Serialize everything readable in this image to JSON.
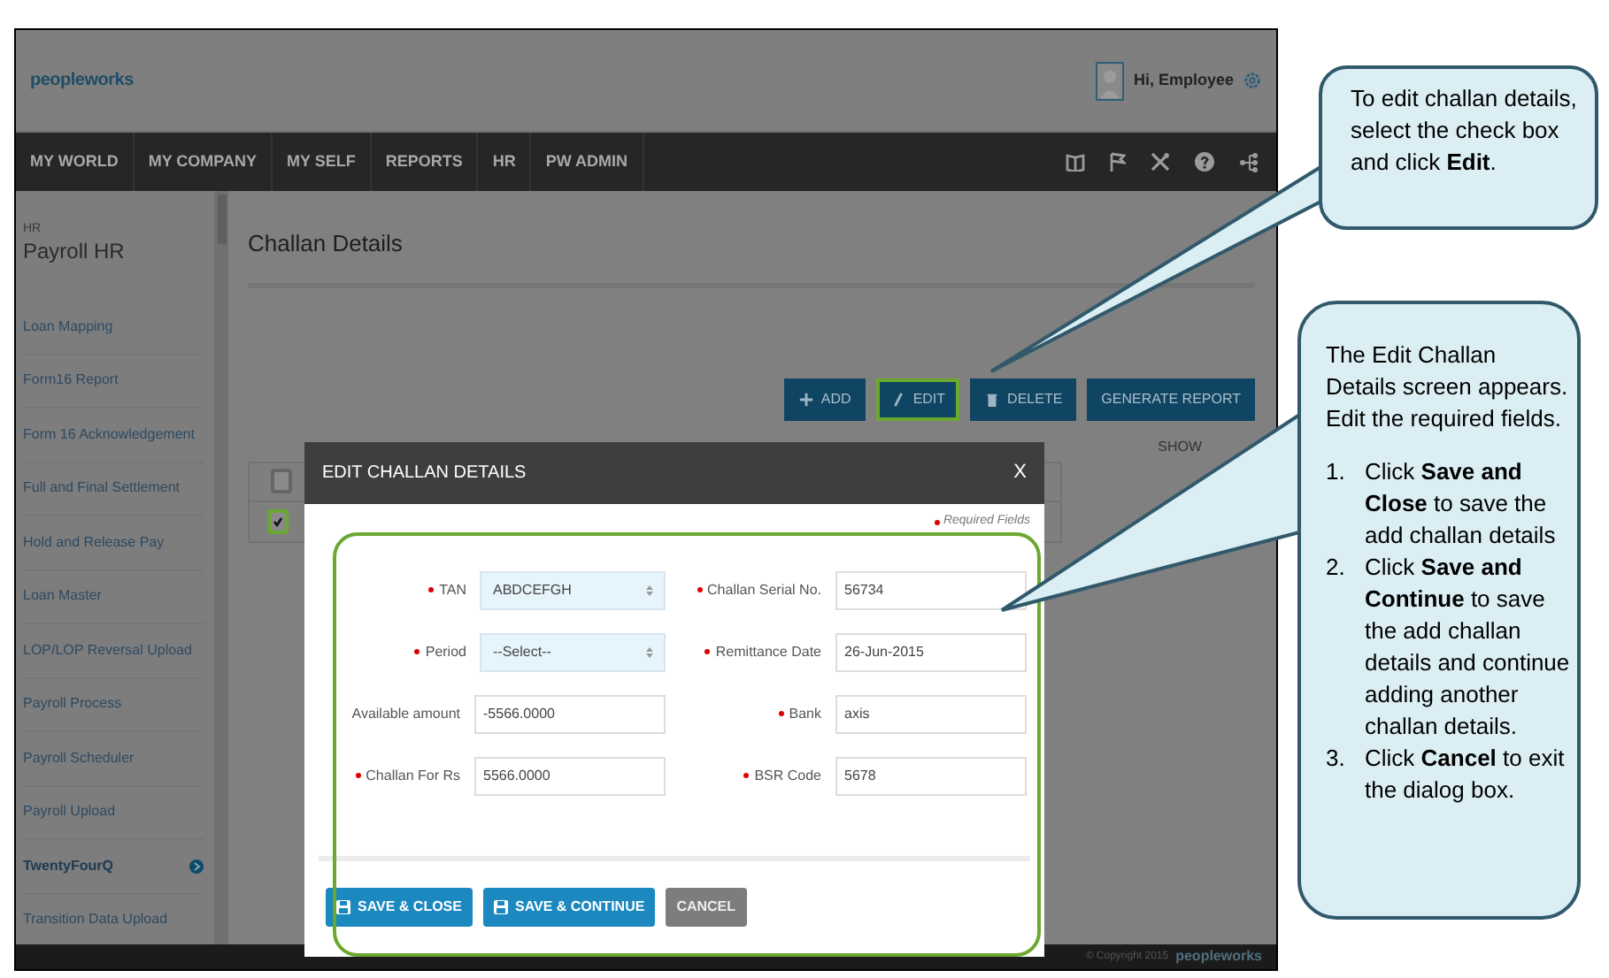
{
  "header": {
    "logo": "peopleworks",
    "greeting": "Hi, Employee"
  },
  "nav": {
    "items": [
      "MY WORLD",
      "MY COMPANY",
      "MY SELF",
      "REPORTS",
      "HR",
      "PW ADMIN"
    ]
  },
  "sidebar": {
    "section": "HR",
    "title": "Payroll HR",
    "items": [
      {
        "label": "Loan Mapping",
        "selected": false
      },
      {
        "label": "Form16 Report",
        "selected": false
      },
      {
        "label": "Form 16 Acknowledgement",
        "selected": false
      },
      {
        "label": "Full and Final Settlement",
        "selected": false
      },
      {
        "label": "Hold and Release Pay",
        "selected": false
      },
      {
        "label": "Loan Master",
        "selected": false
      },
      {
        "label": "LOP/LOP Reversal Upload",
        "selected": false
      },
      {
        "label": "Payroll Process",
        "selected": false
      },
      {
        "label": "Payroll Scheduler",
        "selected": false
      },
      {
        "label": "Payroll Upload",
        "selected": false
      },
      {
        "label": "TwentyFourQ",
        "selected": true
      },
      {
        "label": "Transition Data Upload",
        "selected": false
      }
    ]
  },
  "page": {
    "title": "Challan Details",
    "toolbar": [
      {
        "kind": "add",
        "label": "ADD",
        "highlighted": false
      },
      {
        "kind": "edit",
        "label": "EDIT",
        "highlighted": true
      },
      {
        "kind": "delete",
        "label": "DELETE",
        "highlighted": false
      },
      {
        "kind": "report",
        "label": "GENERATE REPORT",
        "highlighted": false
      }
    ],
    "show_label": "SHOW",
    "table": {
      "header_checked": false,
      "rows": [
        {
          "checked": true,
          "highlighted": true
        }
      ]
    }
  },
  "dialog": {
    "title": "EDIT CHALLAN DETAILS",
    "close": "X",
    "required_note": "Required Fields",
    "fields": [
      {
        "label": "TAN",
        "required": true,
        "kind": "select",
        "value": "ABDCEFGH"
      },
      {
        "label": "Challan Serial No.",
        "required": true,
        "kind": "text",
        "value": "56734"
      },
      {
        "label": "Period",
        "required": true,
        "kind": "select",
        "value": "--Select--"
      },
      {
        "label": "Remittance Date",
        "required": true,
        "kind": "text",
        "value": "26-Jun-2015"
      },
      {
        "label": "Available amount",
        "required": false,
        "kind": "text",
        "value": "-5566.0000"
      },
      {
        "label": "Bank",
        "required": true,
        "kind": "text",
        "value": "axis"
      },
      {
        "label": "Challan For Rs",
        "required": true,
        "kind": "text",
        "value": "5566.0000"
      },
      {
        "label": "BSR Code",
        "required": true,
        "kind": "text",
        "value": "5678"
      }
    ],
    "buttons": [
      {
        "kind": "save",
        "label": "SAVE & CLOSE"
      },
      {
        "kind": "save",
        "label": "SAVE & CONTINUE"
      },
      {
        "kind": "cancel",
        "label": "CANCEL"
      }
    ]
  },
  "footer": {
    "copyright": "© Copyright 2015",
    "brand": "peopleworks"
  },
  "callouts": [
    {
      "text": "To edit challan details, select the check box and click **Edit**."
    },
    {
      "text": "The Edit Challan Details screen appears. Edit the required fields.",
      "steps": [
        {
          "number": "1.",
          "text": "Click **Save and Close** to save the add challan details"
        },
        {
          "number": "2.",
          "text": "Click **Save and Continue** to save the add challan details and continue adding another challan details."
        },
        {
          "number": "3.",
          "text": "Click **Cancel** to exit the dialog box."
        }
      ]
    }
  ]
}
